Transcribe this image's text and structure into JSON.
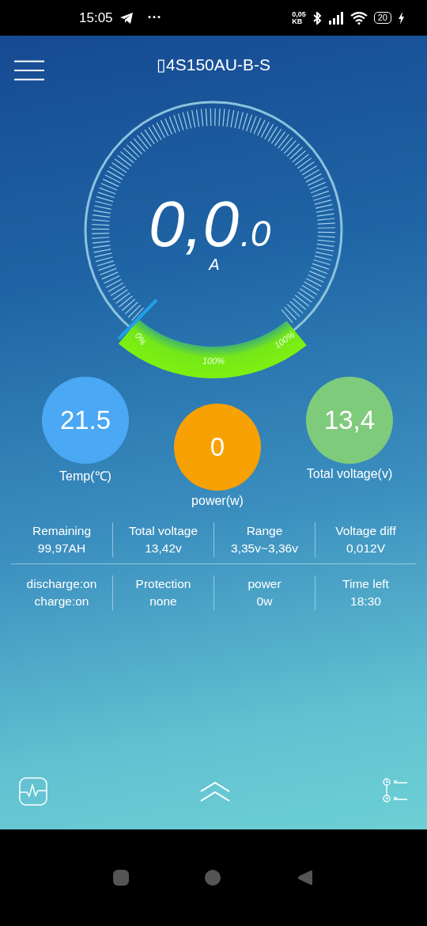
{
  "status_bar": {
    "time": "15:05",
    "more": "···",
    "net_speed": "0,05",
    "net_unit": "KB",
    "battery": "20"
  },
  "header": {
    "title": "▯4S150AU-B-S"
  },
  "gauge": {
    "value": "0,0",
    "decimal": ".0",
    "unit": "A",
    "labels": [
      "0%",
      "100%",
      "100%"
    ]
  },
  "stats": [
    {
      "value": "21.5",
      "label": "Temp(℃)",
      "color": "#4aa8f5"
    },
    {
      "value": "0",
      "label": "power(w)",
      "color": "#f7a104"
    },
    {
      "value": "13,4",
      "label": "Total voltage(v)",
      "color": "#7ecb7c"
    }
  ],
  "table": {
    "rows": [
      [
        [
          "Remaining",
          "99,97AH"
        ],
        [
          "Total voltage",
          "13,42v"
        ],
        [
          "Range",
          "3,35v~3,36v"
        ],
        [
          "Voltage diff",
          "0,012V"
        ]
      ],
      [
        [
          "discharge:on",
          "charge:on"
        ],
        [
          "Protection",
          "none"
        ],
        [
          "power",
          "0w"
        ],
        [
          "Time left",
          "18:30"
        ]
      ]
    ]
  }
}
